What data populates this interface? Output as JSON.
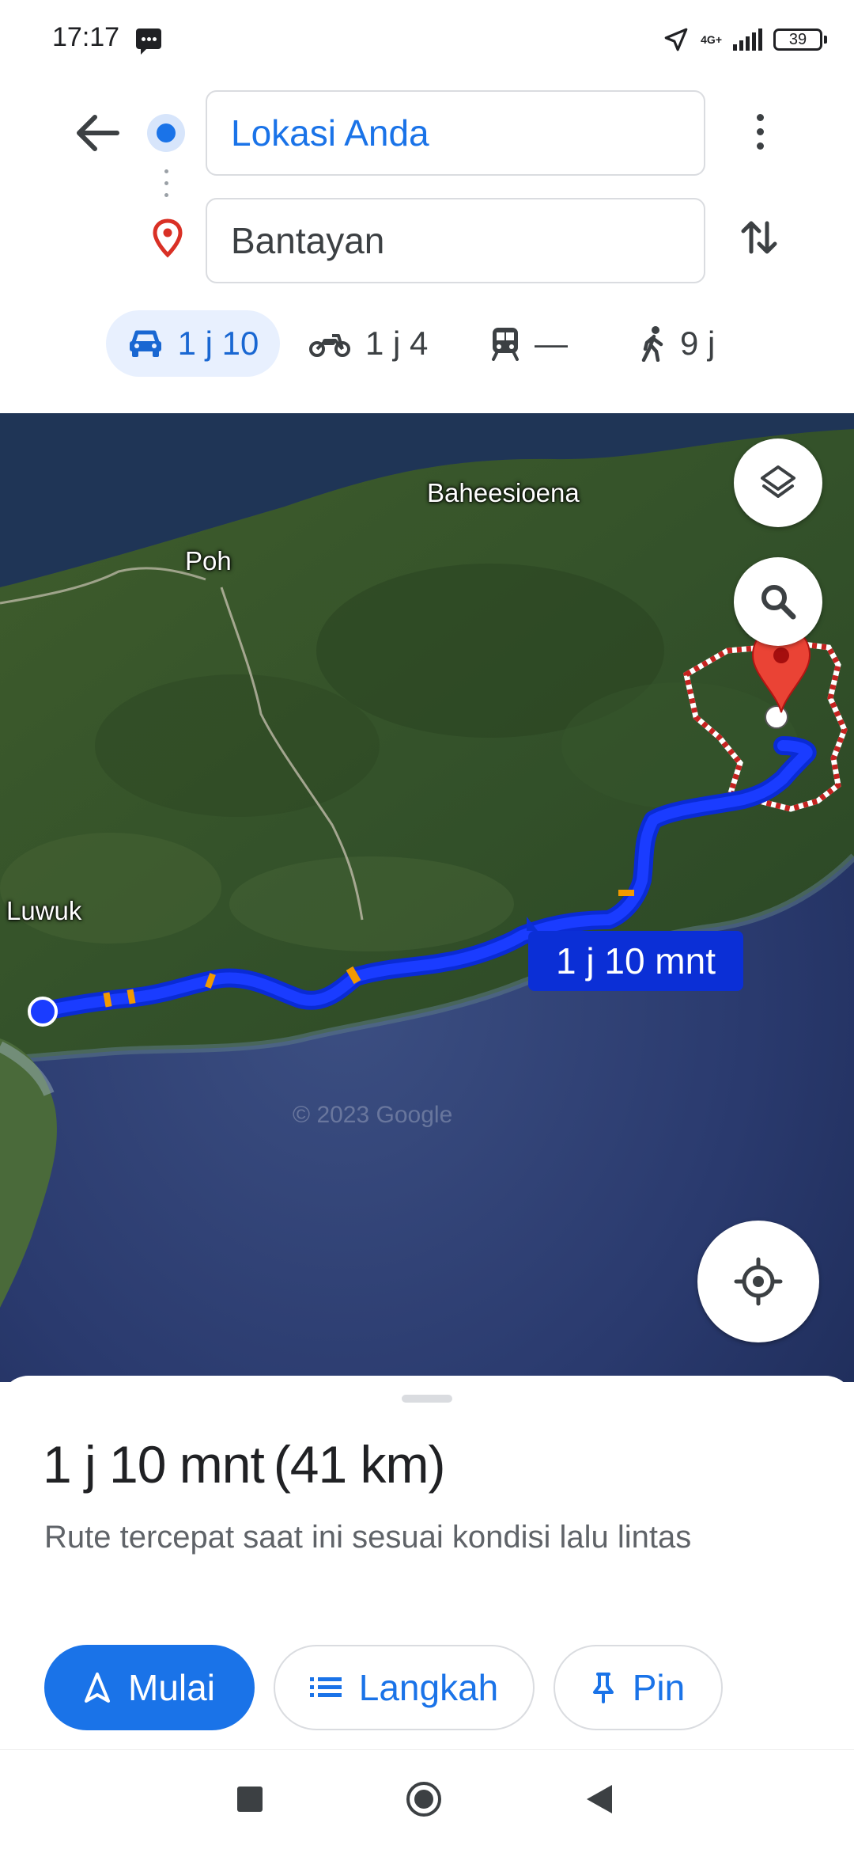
{
  "status_bar": {
    "time": "17:17",
    "network": "4G+",
    "battery": "39",
    "icons": [
      "message-icon",
      "location-arrow-icon",
      "signal-icon",
      "battery-icon"
    ]
  },
  "directions": {
    "origin_value": "Lokasi Anda",
    "destination_value": "Bantayan"
  },
  "modes": [
    {
      "icon": "car-icon",
      "label": "1 j 10",
      "active": true
    },
    {
      "icon": "motorcycle-icon",
      "label": "1 j 4",
      "active": false
    },
    {
      "icon": "train-icon",
      "label": "—",
      "active": false
    },
    {
      "icon": "walk-icon",
      "label": "9 j",
      "active": false
    }
  ],
  "map": {
    "places": [
      "Baheesioena",
      "Poh",
      "Luwuk"
    ],
    "route_label": "1 j 10 mnt",
    "route_color": "#1a3cff",
    "copyright": "© 2023 Google"
  },
  "sheet": {
    "duration": "1 j 10 mnt",
    "distance": "(41 km)",
    "description": "Rute tercepat saat ini sesuai kondisi lalu lintas",
    "buttons": {
      "start": "Mulai",
      "steps": "Langkah",
      "pin": "Pin"
    },
    "accent": "#1a73e8"
  }
}
